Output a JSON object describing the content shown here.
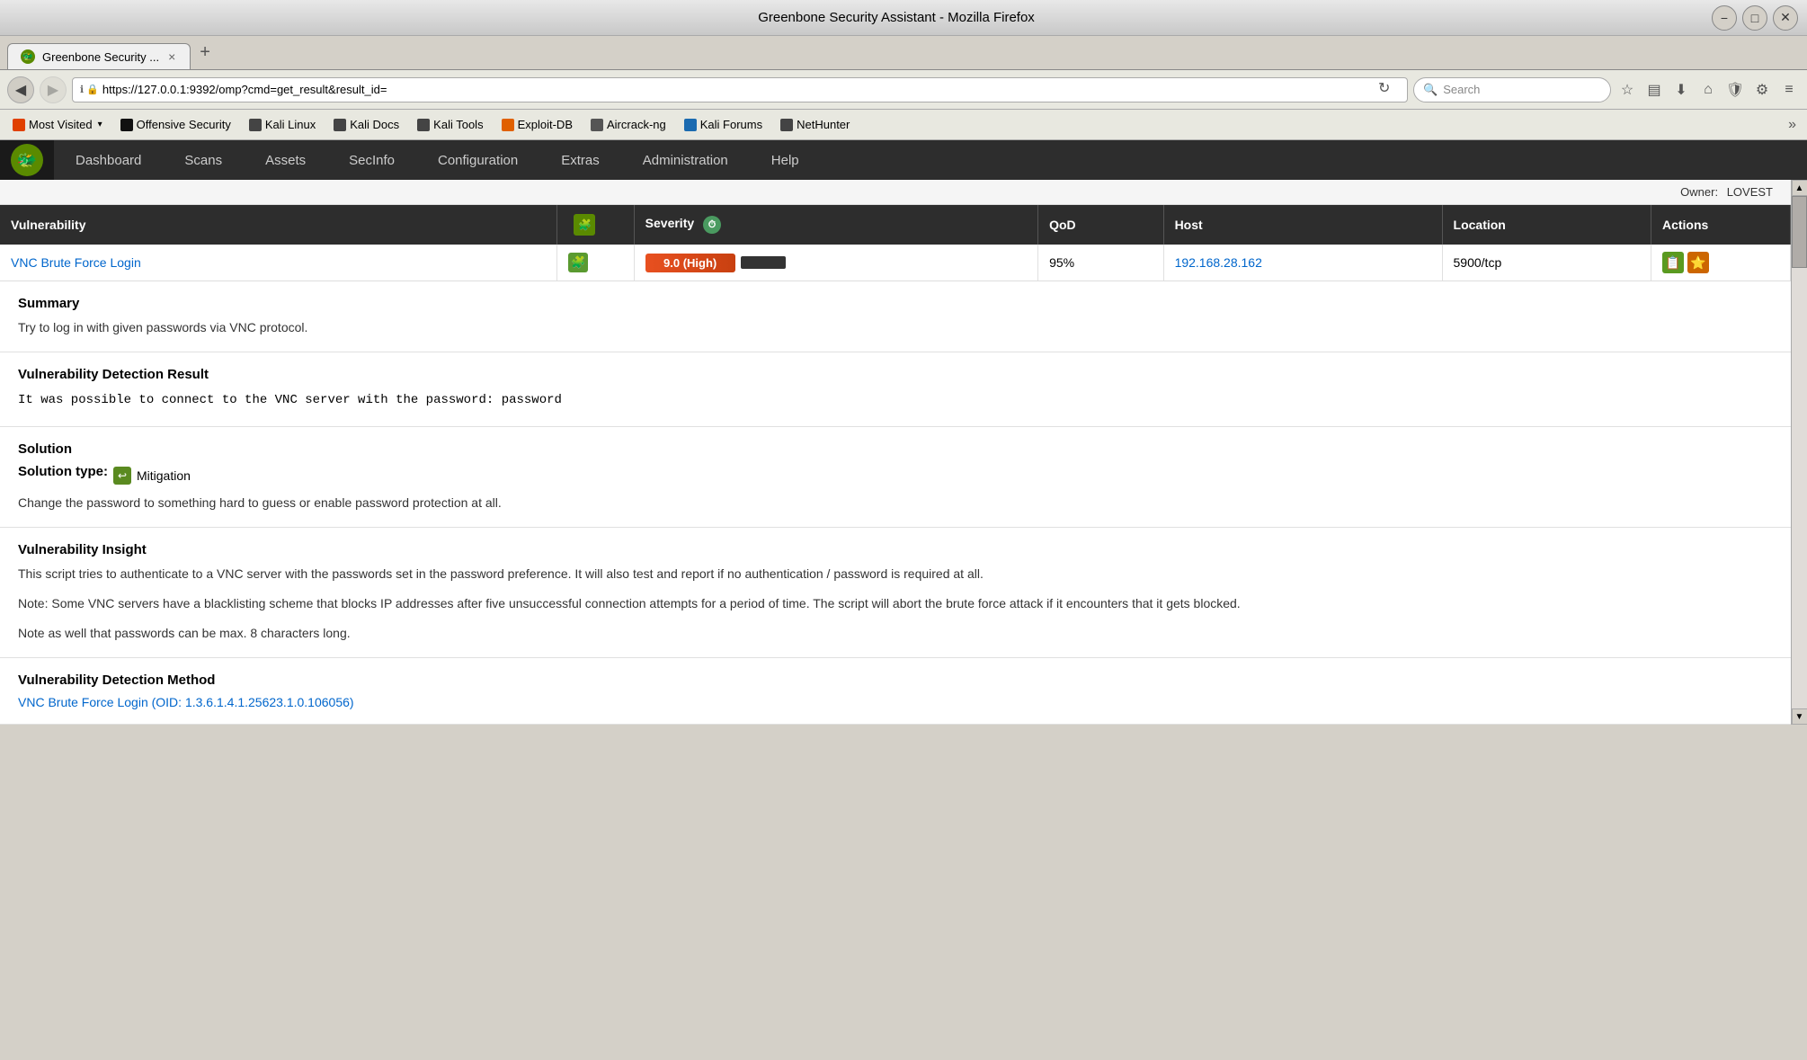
{
  "window": {
    "title": "Greenbone Security Assistant - Mozilla Firefox",
    "min_label": "−",
    "max_label": "□",
    "close_label": "✕"
  },
  "tabs": [
    {
      "label": "Greenbone Security ...",
      "close": "×",
      "active": true
    }
  ],
  "tab_new_label": "+",
  "address_bar": {
    "url": "https://127.0.0.1:9392/omp?cmd=get_result&result_id=",
    "search_placeholder": "Search",
    "info_icon": "ℹ",
    "lock_icon": "🔒"
  },
  "bookmarks": [
    {
      "label": "Most Visited",
      "has_arrow": true
    },
    {
      "label": "Offensive Security"
    },
    {
      "label": "Kali Linux"
    },
    {
      "label": "Kali Docs"
    },
    {
      "label": "Kali Tools"
    },
    {
      "label": "Exploit-DB"
    },
    {
      "label": "Aircrack-ng"
    },
    {
      "label": "Kali Forums"
    },
    {
      "label": "NetHunter"
    }
  ],
  "nav": {
    "items": [
      {
        "label": "Dashboard"
      },
      {
        "label": "Scans"
      },
      {
        "label": "Assets"
      },
      {
        "label": "SecInfo"
      },
      {
        "label": "Configuration"
      },
      {
        "label": "Extras"
      },
      {
        "label": "Administration"
      },
      {
        "label": "Help"
      }
    ]
  },
  "owner_bar": {
    "prefix": "Owner:",
    "value": "LOVEST"
  },
  "table": {
    "headers": [
      {
        "label": "Vulnerability"
      },
      {
        "label": ""
      },
      {
        "label": "Severity"
      },
      {
        "label": "QoD"
      },
      {
        "label": "Host"
      },
      {
        "label": "Location"
      },
      {
        "label": "Actions"
      }
    ],
    "rows": [
      {
        "vuln_name": "VNC Brute Force Login",
        "severity_text": "9.0 (High)",
        "qod": "95%",
        "host": "192.168.28.162",
        "location": "5900/tcp"
      }
    ]
  },
  "sections": {
    "summary": {
      "title": "Summary",
      "text": "Try to log in with given passwords via VNC protocol."
    },
    "detection_result": {
      "title": "Vulnerability Detection Result",
      "text": "It was possible to connect to the VNC server with the password: password"
    },
    "solution": {
      "title": "Solution",
      "type_label": "Solution type:",
      "type_value": "Mitigation",
      "text": "Change the password to something hard to guess or enable password protection at all."
    },
    "insight": {
      "title": "Vulnerability Insight",
      "para1": "This script tries to authenticate to a VNC server with the passwords set in the password preference. It will also test and report if no authentication / password is required at all.",
      "para2": "Note: Some VNC servers have a blacklisting scheme that blocks IP addresses after five unsuccessful connection attempts for a period of time. The script will abort the brute force attack if it encounters that it gets blocked.",
      "para3": "Note as well that passwords can be max. 8 characters long."
    },
    "detection_method": {
      "title": "Vulnerability Detection Method",
      "link_text": "VNC Brute Force Login (OID: 1.3.6.1.4.1.25623.1.0.106056)"
    }
  }
}
